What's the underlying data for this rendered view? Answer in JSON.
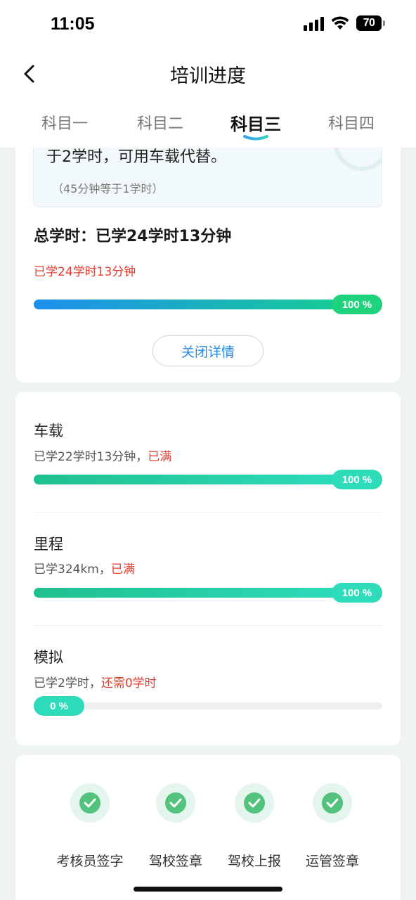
{
  "status_bar": {
    "time": "11:05",
    "battery": "70"
  },
  "header": {
    "title": "培训进度"
  },
  "tabs": [
    {
      "label": "科目一",
      "active": false
    },
    {
      "label": "科目二",
      "active": false
    },
    {
      "label": "科目三",
      "active": true
    },
    {
      "label": "科目四",
      "active": false
    }
  ],
  "summary": {
    "info_text": "于2学时，可用车载代替。",
    "info_note": "（45分钟等于1学时）",
    "total_title": "总学时：已学24学时13分钟",
    "total_sub": "已学24学时13分钟",
    "progress_percent": 100,
    "progress_label": "100 %",
    "close_button": "关闭详情"
  },
  "items": [
    {
      "title": "车载",
      "status": "已学22学时13分钟，",
      "status_warn": "已满",
      "progress_percent": 100,
      "progress_label": "100 %"
    },
    {
      "title": "里程",
      "status": "已学324km，",
      "status_warn": "已满",
      "progress_percent": 100,
      "progress_label": "100 %"
    },
    {
      "title": "模拟",
      "status": "已学2学时，",
      "status_warn": "还需0学时",
      "progress_percent": 0,
      "progress_label": "0 %"
    }
  ],
  "steps": [
    {
      "label": "考核员签字",
      "icon": "check-icon"
    },
    {
      "label": "驾校签章",
      "icon": "check-icon"
    },
    {
      "label": "驾校上报",
      "icon": "check-icon"
    },
    {
      "label": "运管签章",
      "icon": "check-icon"
    }
  ],
  "colors": {
    "accent_blue": "#2a8ae0",
    "accent_green": "#1ed37c",
    "teal": "#22c79a",
    "warn_red": "#e33b2e",
    "check_green": "#52c27d"
  }
}
